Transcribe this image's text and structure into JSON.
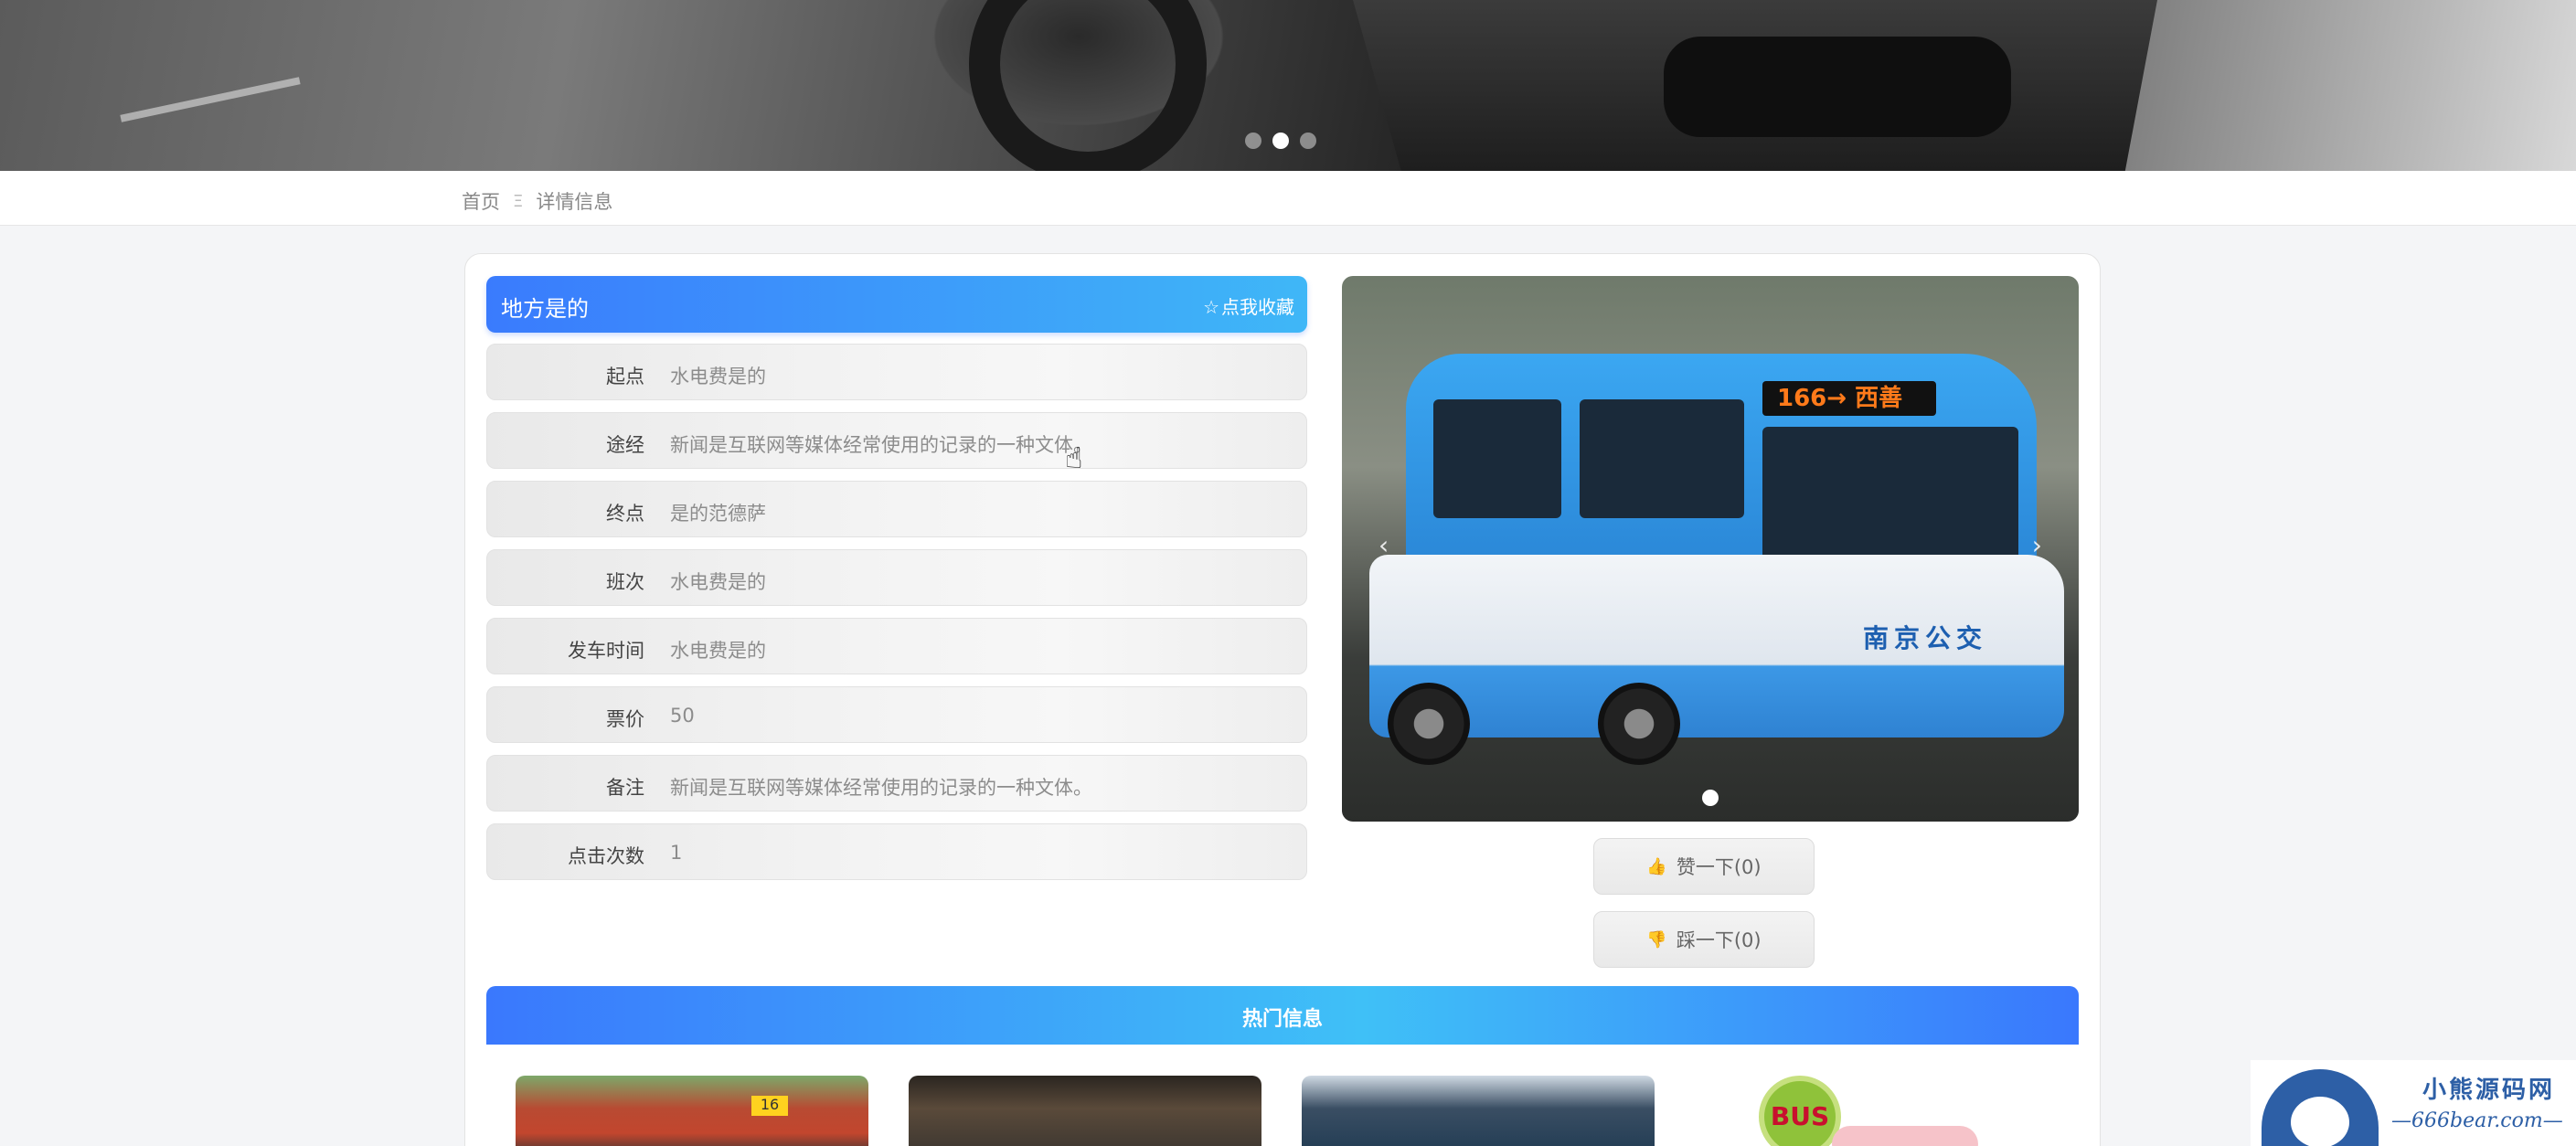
{
  "banner": {
    "dots": [
      false,
      true,
      false
    ]
  },
  "breadcrumb": {
    "home": "首页",
    "separator": "Ξ",
    "current": "详情信息"
  },
  "detail": {
    "title": "地方是的",
    "favorite_label": "点我收藏",
    "fields": [
      {
        "label": "起点",
        "value": "水电费是的"
      },
      {
        "label": "途经",
        "value": "新闻是互联网等媒体经常使用的记录的一种文体。"
      },
      {
        "label": "终点",
        "value": "是的范德萨"
      },
      {
        "label": "班次",
        "value": "水电费是的"
      },
      {
        "label": "发车时间",
        "value": "水电费是的"
      },
      {
        "label": "票价",
        "value": "50"
      },
      {
        "label": "备注",
        "value": "新闻是互联网等媒体经常使用的记录的一种文体。"
      },
      {
        "label": "点击次数",
        "value": "1"
      }
    ]
  },
  "slider": {
    "bus_sign": "166→ 西善",
    "bus_brand": "南京公交",
    "prev": "‹",
    "next": "›"
  },
  "votes": {
    "like_label": "赞一下(0)",
    "dislike_label": "踩一下(0)"
  },
  "hot": {
    "title": "热门信息",
    "thumb_plate": "16",
    "thumb_bus_text": "BUS"
  },
  "watermark": {
    "cn": "小熊源码网",
    "en": "—666bear.com—"
  },
  "colors": {
    "accent_start": "#3a7bfd",
    "accent_end": "#3fb7f7"
  }
}
